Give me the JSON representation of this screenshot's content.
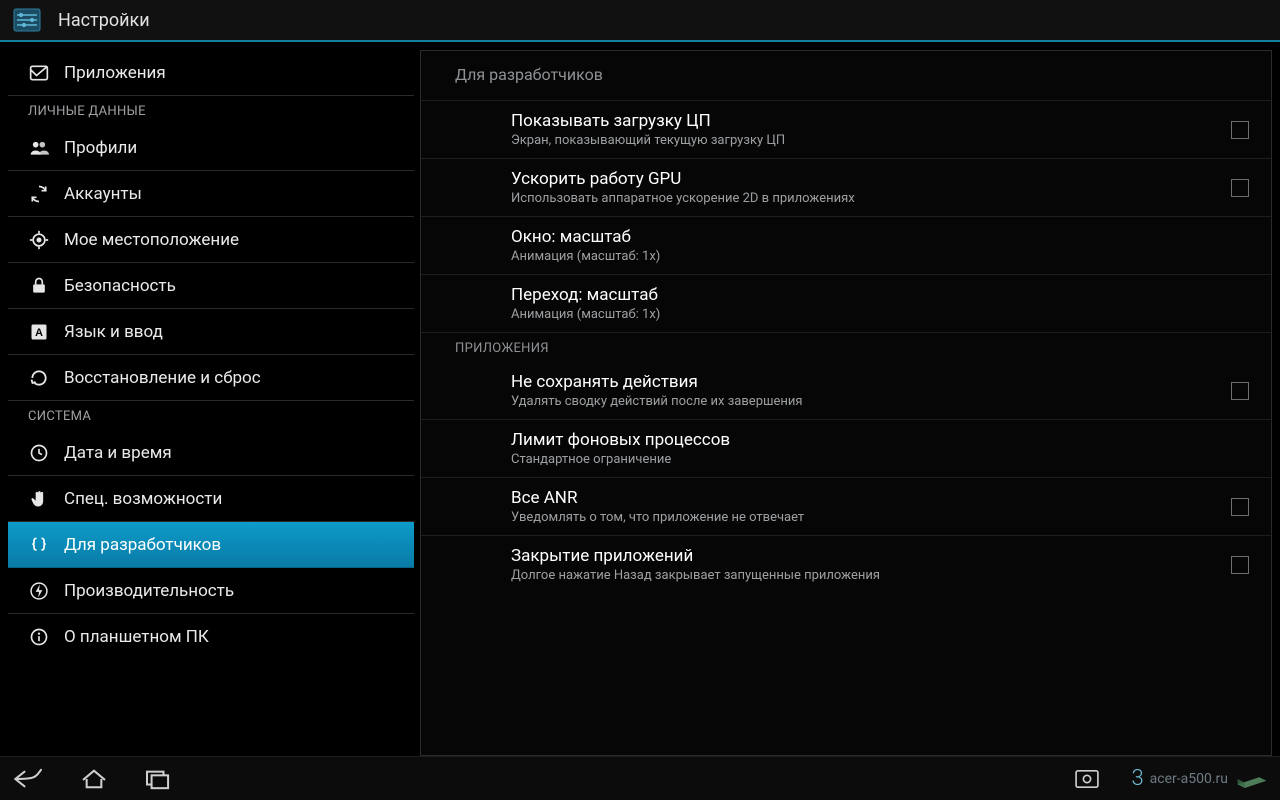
{
  "appbar": {
    "title": "Настройки"
  },
  "sidebar": {
    "sections": {
      "personal": "ЛИЧНЫЕ ДАННЫЕ",
      "system": "СИСТЕМА"
    },
    "items": [
      {
        "label": "Приложения"
      },
      {
        "label": "Профили"
      },
      {
        "label": "Аккаунты"
      },
      {
        "label": "Мое местоположение"
      },
      {
        "label": "Безопасность"
      },
      {
        "label": "Язык и ввод"
      },
      {
        "label": "Восстановление и сброс"
      },
      {
        "label": "Дата и время"
      },
      {
        "label": "Спец. возможности"
      },
      {
        "label": "Для разработчиков",
        "selected": true
      },
      {
        "label": "Производительность"
      },
      {
        "label": "О планшетном ПК"
      }
    ]
  },
  "panel": {
    "title": "Для разработчиков",
    "groups": {
      "apps": "ПРИЛОЖЕНИЯ"
    },
    "rows": [
      {
        "title": "Показывать загрузку ЦП",
        "subtitle": "Экран, показывающий текущую загрузку ЦП",
        "checkbox": false
      },
      {
        "title": "Ускорить работу GPU",
        "subtitle": "Использовать аппаратное ускорение 2D в приложениях",
        "checkbox": false
      },
      {
        "title": "Окно: масштаб",
        "subtitle": "Анимация (масштаб: 1х)"
      },
      {
        "title": "Переход: масштаб",
        "subtitle": "Анимация (масштаб: 1х)"
      },
      {
        "title": "Не сохранять действия",
        "subtitle": "Удалять сводку действий после их завершения",
        "checkbox": false
      },
      {
        "title": "Лимит фоновых процессов",
        "subtitle": "Стандартное ограничение"
      },
      {
        "title": "Все ANR",
        "subtitle": "Уведомлять о том, что приложение не отвечает",
        "checkbox": false
      },
      {
        "title": "Закрытие приложений",
        "subtitle": "Долгое нажатие Назад закрывает запущенные приложения",
        "checkbox": false
      }
    ]
  },
  "navbar": {
    "watermark_number": "3",
    "watermark_text": "acer-a500.ru"
  }
}
